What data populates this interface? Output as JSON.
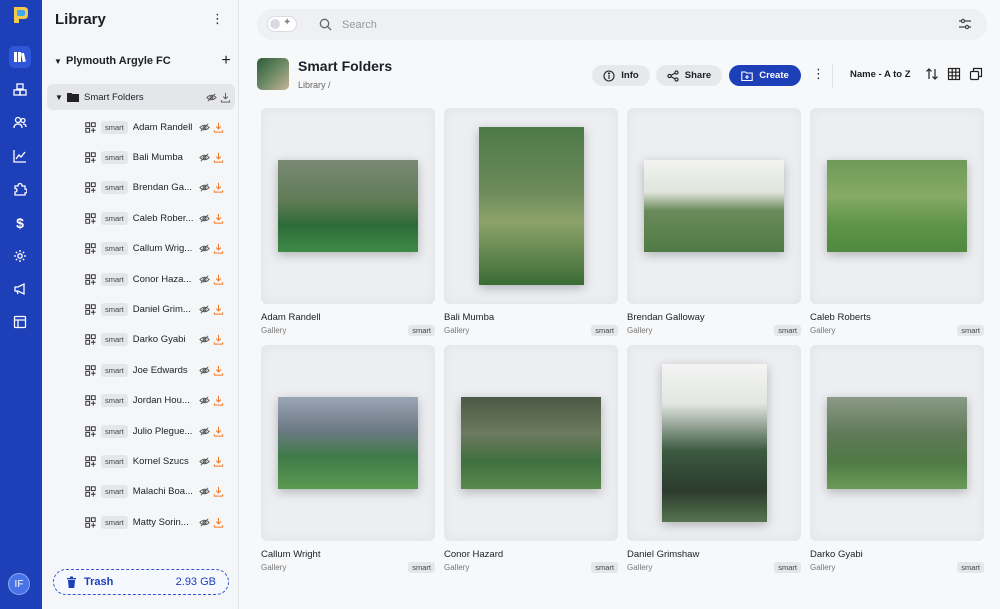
{
  "sidebar": {
    "title": "Library",
    "club": "Plymouth Argyle FC",
    "folder": "Smart Folders",
    "items": [
      {
        "tag": "smart",
        "name": "Adam Randell"
      },
      {
        "tag": "smart",
        "name": "Bali Mumba"
      },
      {
        "tag": "smart",
        "name": "Brendan Ga..."
      },
      {
        "tag": "smart",
        "name": "Caleb Rober..."
      },
      {
        "tag": "smart",
        "name": "Callum Wrig..."
      },
      {
        "tag": "smart",
        "name": "Conor Haza..."
      },
      {
        "tag": "smart",
        "name": "Daniel Grim..."
      },
      {
        "tag": "smart",
        "name": "Darko Gyabi"
      },
      {
        "tag": "smart",
        "name": "Joe Edwards"
      },
      {
        "tag": "smart",
        "name": "Jordan Hou..."
      },
      {
        "tag": "smart",
        "name": "Julio Plegue..."
      },
      {
        "tag": "smart",
        "name": "Kornel Szucs"
      },
      {
        "tag": "smart",
        "name": "Malachi Boa..."
      },
      {
        "tag": "smart",
        "name": "Matty Sorin..."
      }
    ],
    "trash_label": "Trash",
    "trash_size": "2.93 GB",
    "avatar": "IF"
  },
  "search": {
    "placeholder": "Search"
  },
  "header": {
    "title": "Smart Folders",
    "breadcrumb": "Library /",
    "info": "Info",
    "share": "Share",
    "create": "Create",
    "sort": "Name - A to Z"
  },
  "cards": [
    {
      "name": "Adam Randell",
      "sub": "Gallery",
      "tag": "smart"
    },
    {
      "name": "Bali Mumba",
      "sub": "Gallery",
      "tag": "smart"
    },
    {
      "name": "Brendan Galloway",
      "sub": "Gallery",
      "tag": "smart"
    },
    {
      "name": "Caleb Roberts",
      "sub": "Gallery",
      "tag": "smart"
    },
    {
      "name": "Callum Wright",
      "sub": "Gallery",
      "tag": "smart"
    },
    {
      "name": "Conor Hazard",
      "sub": "Gallery",
      "tag": "smart"
    },
    {
      "name": "Daniel Grimshaw",
      "sub": "Gallery",
      "tag": "smart"
    },
    {
      "name": "Darko Gyabi",
      "sub": "Gallery",
      "tag": "smart"
    }
  ],
  "colors": {
    "brand": "#1d3fb8",
    "accent": "#f07a2a"
  },
  "icons": {
    "rail": [
      "library-icon",
      "boxes-icon",
      "users-icon",
      "chart-icon",
      "puzzle-icon",
      "dollar-icon",
      "gear-icon",
      "megaphone-icon",
      "layout-icon"
    ]
  }
}
